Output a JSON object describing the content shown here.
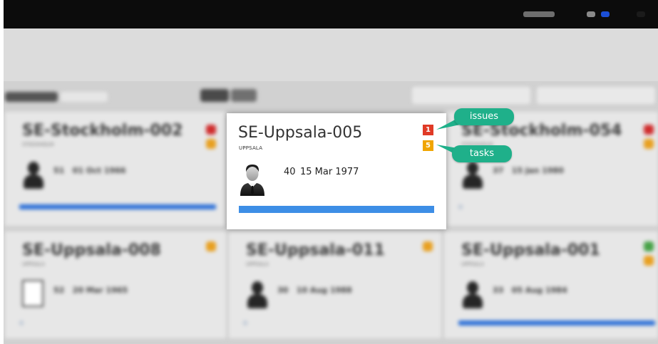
{
  "colors": {
    "accent_teal": "#1fb08a",
    "issue_red": "#e03a26",
    "task_orange": "#f0a500",
    "progress_blue": "#3d8ee6"
  },
  "focused_card": {
    "title": "SE-Uppsala-005",
    "subtitle": "UPPSALA",
    "age": "40",
    "date": "15 Mar 1977",
    "issues_count": "1",
    "tasks_count": "5",
    "progress": 1.0,
    "avatar_icon": "man-in-suit-icon"
  },
  "callouts": {
    "issues_label": "issues",
    "tasks_label": "tasks"
  }
}
